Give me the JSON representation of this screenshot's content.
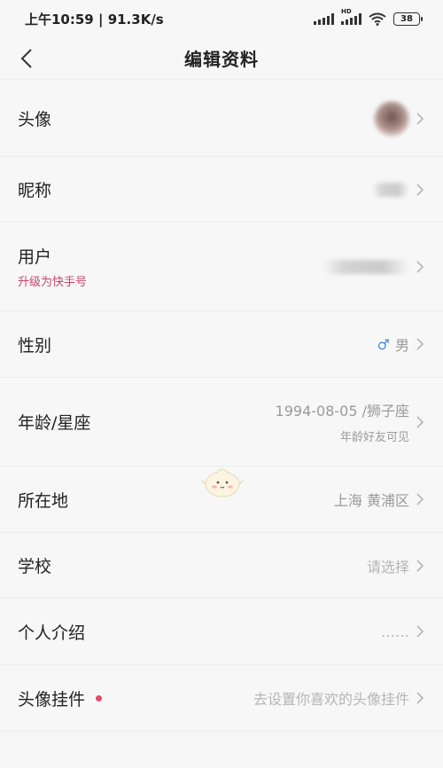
{
  "status_bar": {
    "time": "上午10:59",
    "speed": "91.3K/s",
    "network_tag": "HD",
    "battery": "38"
  },
  "header": {
    "title": "编辑资料"
  },
  "rows": {
    "avatar": {
      "label": "头像"
    },
    "nickname": {
      "label": "昵称"
    },
    "user": {
      "label": "用户",
      "sub": "升级为快手号"
    },
    "gender": {
      "label": "性别",
      "symbol": "♂",
      "value": "男"
    },
    "age": {
      "label": "年龄/星座",
      "value": "1994-08-05 /狮子座",
      "sub": "年龄好友可见"
    },
    "location": {
      "label": "所在地",
      "value": "上海 黄浦区"
    },
    "school": {
      "label": "学校",
      "value": "请选择"
    },
    "intro": {
      "label": "个人介绍",
      "value": "……"
    },
    "pendant": {
      "label": "头像挂件",
      "value": "去设置你喜欢的头像挂件"
    }
  },
  "icons": {
    "back": "back-arrow-icon",
    "chevron": "chevron-right-icon",
    "signal": "signal-icon",
    "wifi": "wifi-icon",
    "battery": "battery-icon"
  },
  "colors": {
    "background": "#f7f7f7",
    "accent_pink": "#c8476b",
    "red_dot": "#e84a6a",
    "gender_blue": "#4a8fd4",
    "value_gray": "#9a9a9a"
  }
}
